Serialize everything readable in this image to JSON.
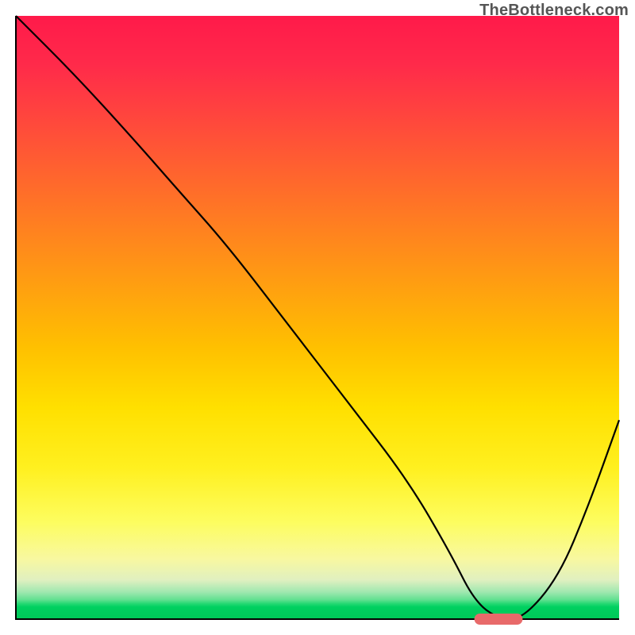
{
  "attribution": "TheBottleneck.com",
  "colors": {
    "gradient_top": "#ff1a4a",
    "gradient_mid": "#ffe000",
    "gradient_bottom": "#00c858",
    "curve": "#000000",
    "marker": "#e86a6a",
    "axis": "#000000"
  },
  "chart_data": {
    "type": "line",
    "title": "",
    "xlabel": "",
    "ylabel": "",
    "xlim": [
      0,
      100
    ],
    "ylim": [
      0,
      100
    ],
    "x": [
      0,
      10,
      20,
      27,
      35,
      45,
      55,
      65,
      72,
      76,
      80,
      84,
      90,
      95,
      100
    ],
    "values": [
      100,
      90,
      79,
      71,
      62,
      49,
      36,
      23,
      11,
      3,
      0,
      0,
      7,
      19,
      33
    ],
    "marker": {
      "x_start": 76,
      "x_end": 84,
      "y": 0
    },
    "annotations": []
  }
}
